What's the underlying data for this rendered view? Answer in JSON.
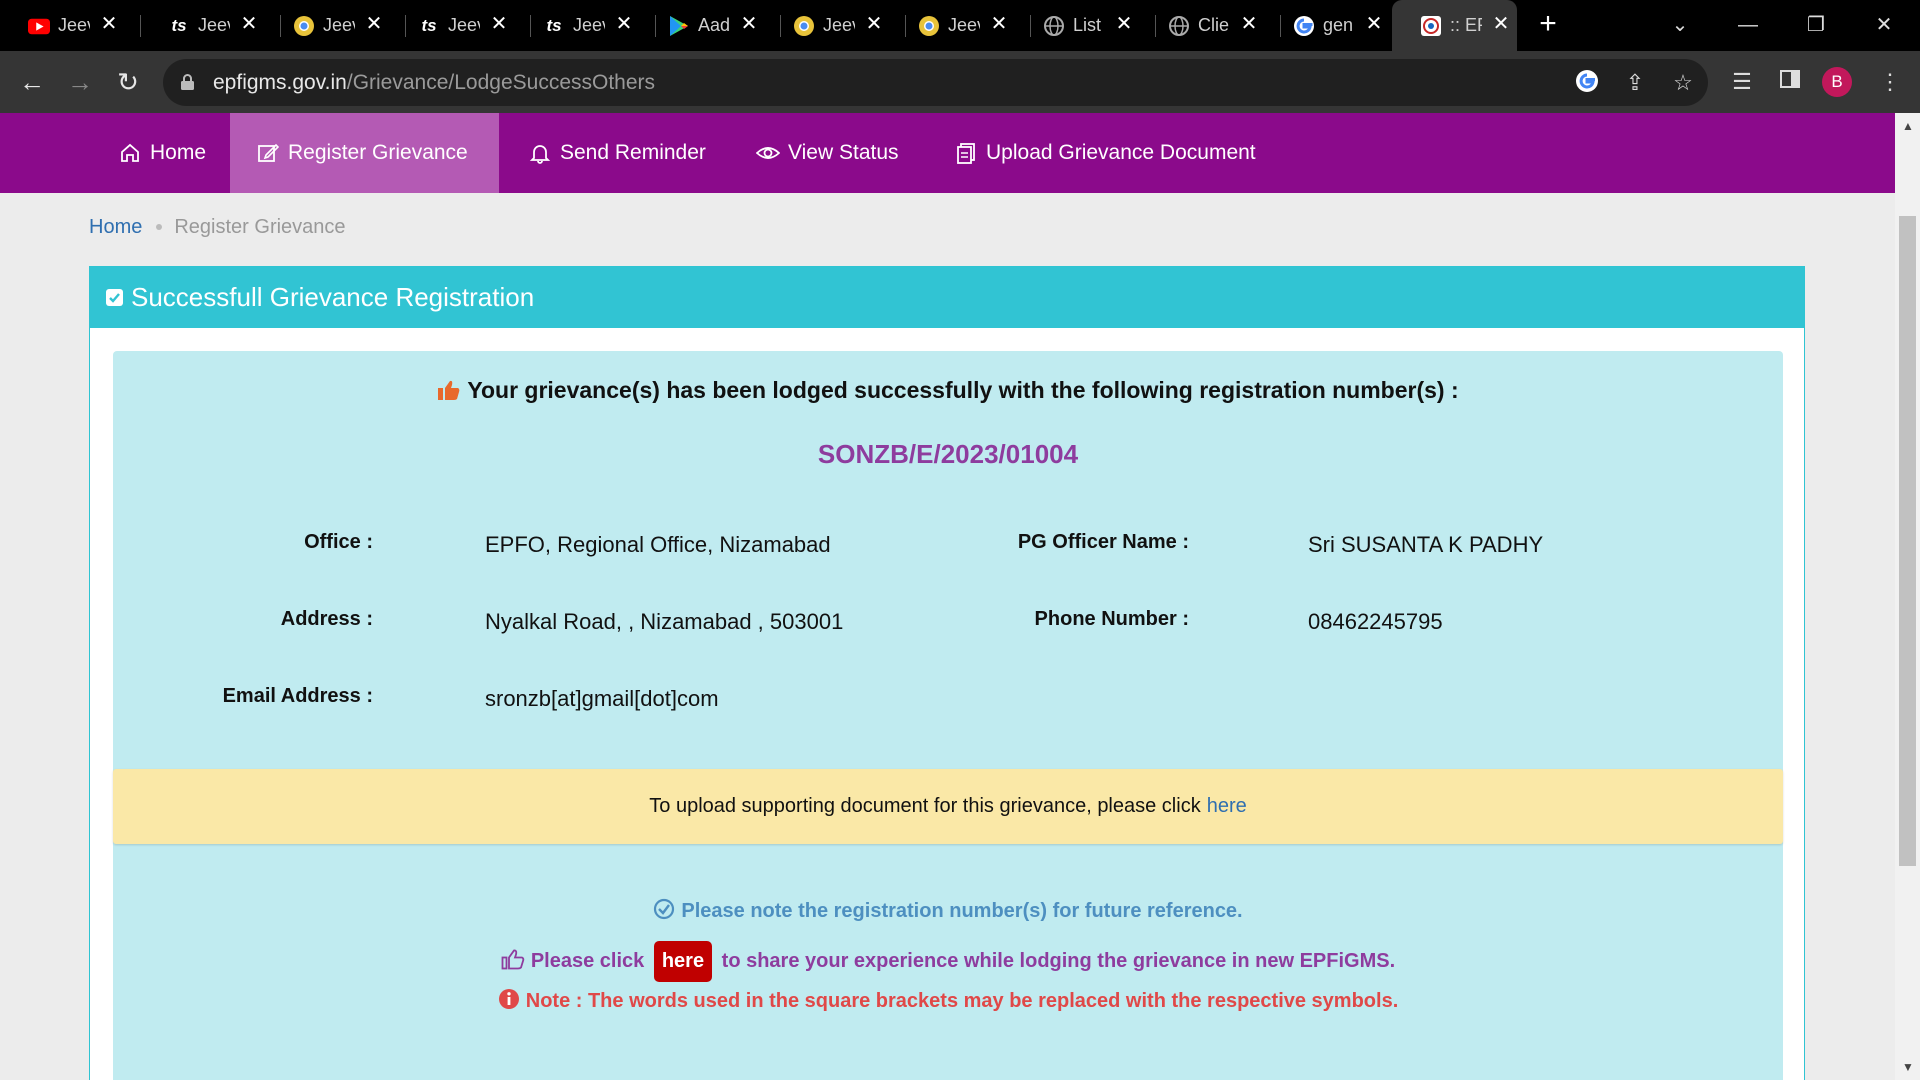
{
  "browser": {
    "tabs": [
      {
        "icon": "youtube-icon",
        "title": "Jeev"
      },
      {
        "icon": "ts-icon",
        "title": "Jeev"
      },
      {
        "icon": "chrome-icon",
        "title": "Jeev"
      },
      {
        "icon": "ts-icon",
        "title": "Jeev"
      },
      {
        "icon": "ts-icon",
        "title": "Jeev"
      },
      {
        "icon": "play-store-icon",
        "title": "Aad"
      },
      {
        "icon": "chrome-icon",
        "title": "Jeev"
      },
      {
        "icon": "chrome-icon",
        "title": "Jeev"
      },
      {
        "icon": "globe-icon",
        "title": "List"
      },
      {
        "icon": "globe-icon",
        "title": "Clie"
      },
      {
        "icon": "google-icon",
        "title": "gen"
      },
      {
        "icon": "epfo-icon",
        "title": ":: EP"
      }
    ],
    "ts_glyph": "ts",
    "url_host": "epfigms.gov.in",
    "url_path": "/Grievance/LodgeSuccessOthers",
    "avatar_letter": "B"
  },
  "nav": {
    "home": "Home",
    "register": "Register Grievance",
    "reminder": "Send Reminder",
    "status": "View Status",
    "upload": "Upload Grievance Document"
  },
  "breadcrumb": {
    "home": "Home",
    "current": "Register Grievance"
  },
  "panel": {
    "title": "Successfull Grievance Registration",
    "lead": "Your grievance(s) has been lodged successfully with the following registration number(s) :",
    "registration_number": "SONZB/E/2023/01004",
    "fields": {
      "office_label": "Office :",
      "office_value": "EPFO, Regional Office, Nizamabad",
      "pg_officer_label": "PG Officer Name :",
      "pg_officer_value": "Sri SUSANTA K PADHY",
      "address_label": "Address :",
      "address_value": "Nyalkal Road, , Nizamabad , 503001",
      "phone_label": "Phone Number :",
      "phone_value": "08462245795",
      "email_label": "Email Address :",
      "email_value": "sronzb[at]gmail[dot]com"
    },
    "notice_text": "To upload supporting document for this grievance, please click",
    "notice_link": "here",
    "note_reference": "Please note the registration number(s) for future reference.",
    "feedback_prefix": "Please click",
    "feedback_button": "here",
    "feedback_suffix": "to share your experience while lodging the grievance in new EPFiGMS.",
    "note_symbols": "Note : The words used in the square brackets may be replaced with the respective symbols."
  },
  "colors": {
    "nav_bg": "#8b0a8b",
    "nav_active": "#b45ab4",
    "panel_head": "#31c4d3",
    "success_bg": "#c0ebf0",
    "regno": "#8e3c9e",
    "notice_bg": "#fae8a7",
    "button_red": "#c00000"
  }
}
